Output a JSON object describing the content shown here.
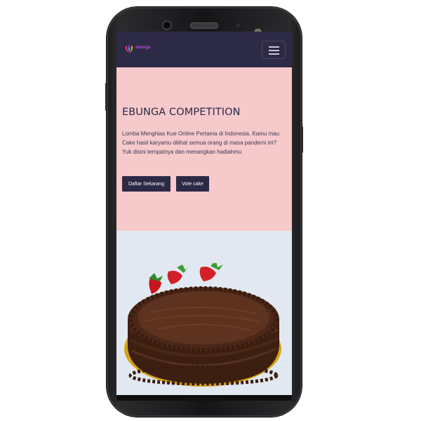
{
  "navbar": {
    "brand_name": "ebunga",
    "menu_icon": "hamburger-menu-icon"
  },
  "hero": {
    "title": "EBUNGA COMPETITION",
    "description_line1": "Lomba Menghias Kue Online Pertama di Indonesia. Kamu mau Cake hasil karyamu dilihat semua orang di masa pandemi ini?",
    "description_line2": "Yuk disini tempatnya dan menangkan hadiahmu",
    "primary_button": "Daftar Sekarang",
    "secondary_button": "Vote cake"
  },
  "showcase": {
    "image_name": "chocolate-cake-image"
  },
  "colors": {
    "navbar_bg": "#2d2a45",
    "hero_bg": "#f6c9cb",
    "showcase_bg": "#e2e8f1",
    "button_bg": "#2d2a45",
    "brand_text": "#b24bd6"
  }
}
